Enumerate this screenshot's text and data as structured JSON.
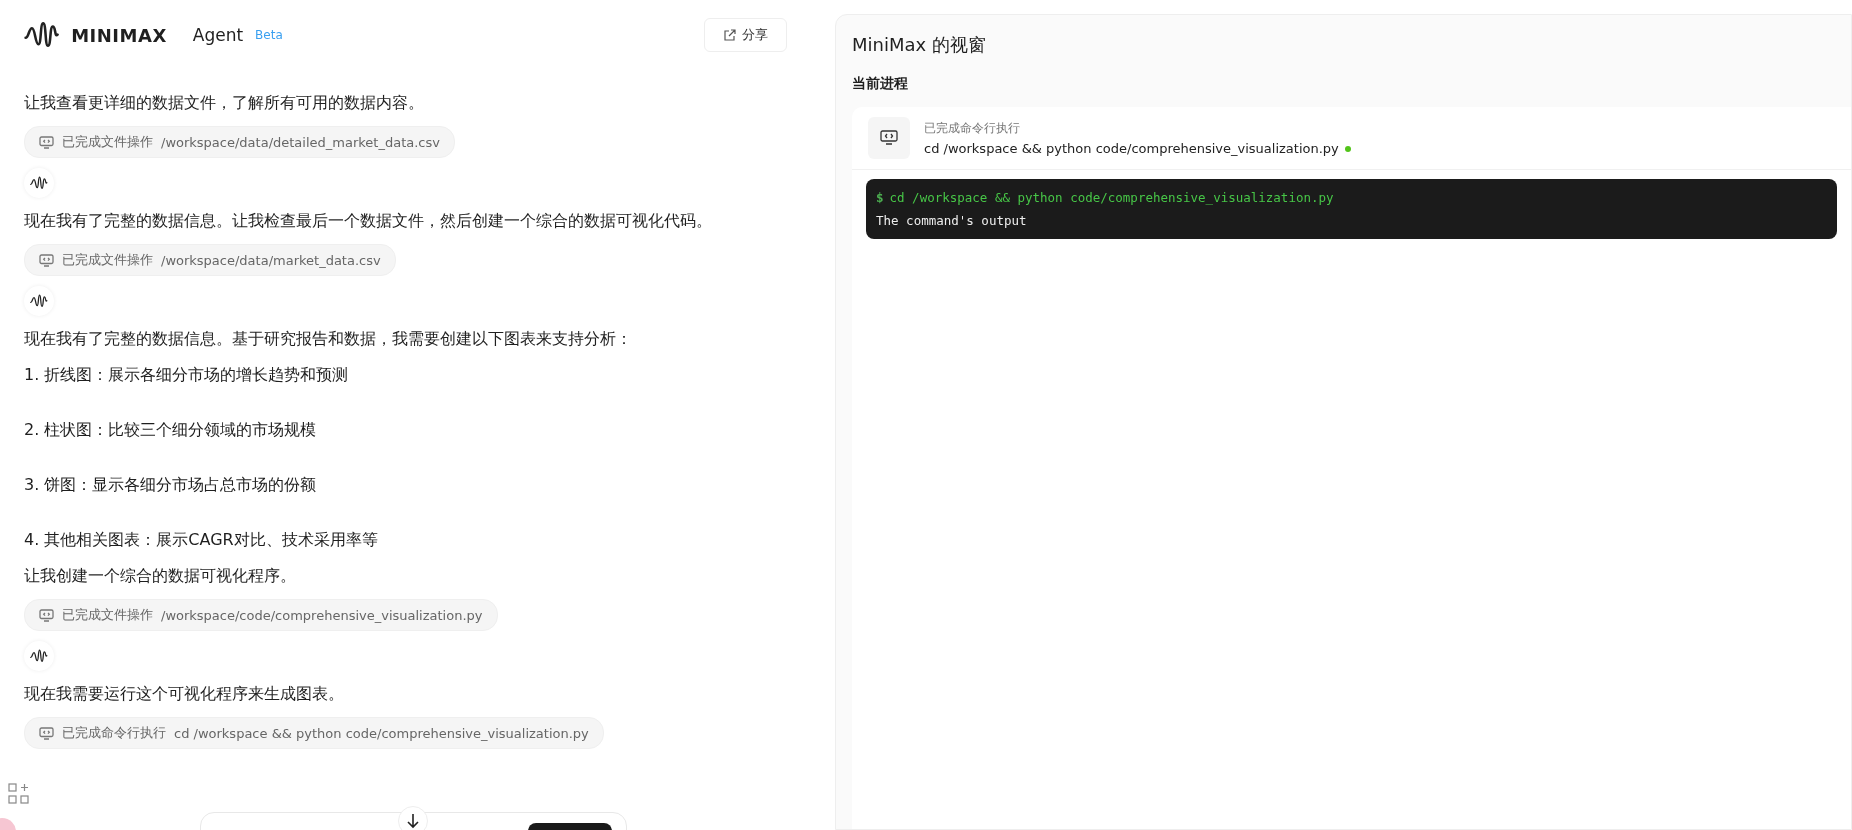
{
  "header": {
    "brand": "MINIMAX",
    "product": "Agent",
    "badge": "Beta",
    "share": "分享"
  },
  "messages": [
    {
      "kind": "text",
      "text": "让我查看更详细的数据文件，了解所有可用的数据内容。"
    },
    {
      "kind": "tool",
      "status": "已完成文件操作",
      "detail": "/workspace/data/detailed_market_data.csv"
    },
    {
      "kind": "avatar"
    },
    {
      "kind": "text",
      "text": "现在我有了完整的数据信息。让我检查最后一个数据文件，然后创建一个综合的数据可视化代码。"
    },
    {
      "kind": "tool",
      "status": "已完成文件操作",
      "detail": "/workspace/data/market_data.csv"
    },
    {
      "kind": "avatar"
    },
    {
      "kind": "text",
      "text": "现在我有了完整的数据信息。基于研究报告和数据，我需要创建以下图表来支持分析："
    },
    {
      "kind": "list_item",
      "text": "1. 折线图：展示各细分市场的增长趋势和预测"
    },
    {
      "kind": "list_item",
      "text": "2. 柱状图：比较三个细分领域的市场规模"
    },
    {
      "kind": "list_item",
      "text": "3. 饼图：显示各细分市场占总市场的份额"
    },
    {
      "kind": "list_item",
      "text": "4. 其他相关图表：展示CAGR对比、技术采用率等"
    },
    {
      "kind": "text",
      "text": "让我创建一个综合的数据可视化程序。"
    },
    {
      "kind": "tool",
      "status": "已完成文件操作",
      "detail": "/workspace/code/comprehensive_visualization.py"
    },
    {
      "kind": "avatar"
    },
    {
      "kind": "text",
      "text": "现在我需要运行这个可视化程序来生成图表。"
    },
    {
      "kind": "tool",
      "status": "已完成命令行执行",
      "detail": "cd /workspace && python code/comprehensive_visualization.py"
    }
  ],
  "panel": {
    "title": "MiniMax 的视窗",
    "section": "当前进程",
    "process": {
      "status": "已完成命令行执行",
      "command": "cd /workspace && python code/comprehensive_visualization.py"
    },
    "terminal": {
      "prompt": "$",
      "command": "cd /workspace && python code/comprehensive_visualization.py",
      "output": "The command's output"
    }
  }
}
